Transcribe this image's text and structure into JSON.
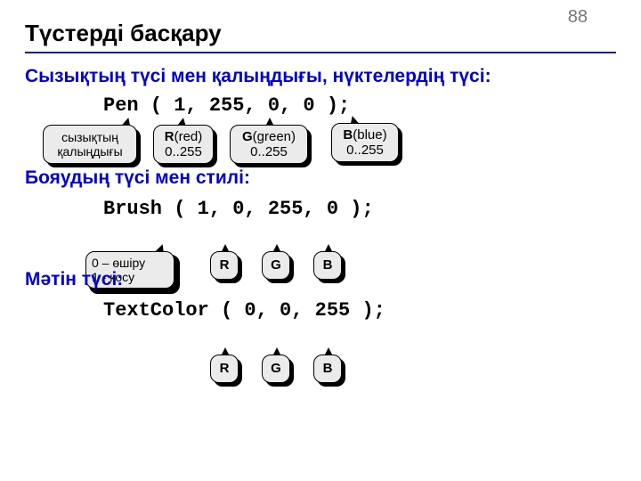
{
  "page_number": "88",
  "title": "Түстерді басқару",
  "sec1": "Сызықтың түсі мен қалыңдығы, нүктелердің түсі:",
  "code1": "Pen ( 1, 255, 0, 0 );",
  "sec2": "Бояудың түсі мен стилі:",
  "code2": "Brush ( 1, 0, 255, 0 );",
  "sec3": "Мәтін түсі:",
  "code3": "TextColor ( 0, 0, 255 );",
  "callouts": {
    "thickness_l1": "сызықтың",
    "thickness_l2": "қалыңдығы",
    "r_l1": "R(red)",
    "g_l1": "G(green)",
    "b_l1": "B(blue)",
    "range": "0..255",
    "toggle_l1": "0 – өшіру",
    "toggle_l2": "1 - қосу",
    "R": "R",
    "G": "G",
    "B": "B"
  }
}
